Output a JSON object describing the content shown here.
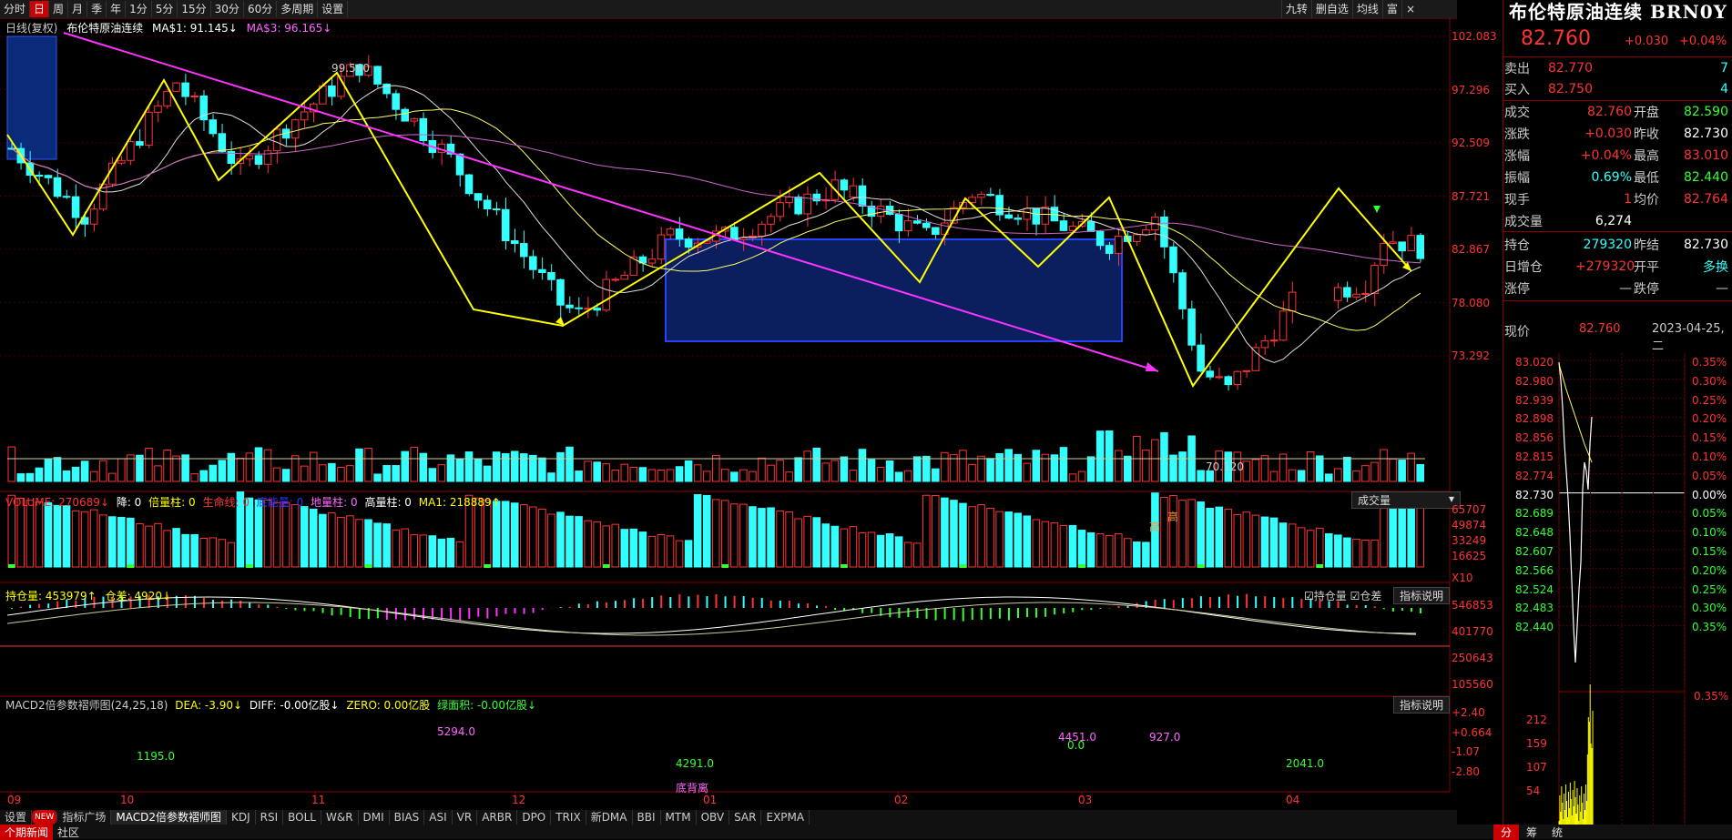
{
  "toolbar": {
    "periods": [
      "分时",
      "日",
      "周",
      "月",
      "季",
      "年",
      "1分",
      "5分",
      "15分",
      "30分",
      "60分",
      "多周期",
      "设置"
    ],
    "active_period": "日",
    "right_items": [
      "九转",
      "删自选",
      "均线",
      "富"
    ],
    "close": "×"
  },
  "kline": {
    "header_mode": "日线(复权)",
    "name": "布伦特原油连续",
    "ma1": "MA$1: 91.145↓",
    "ma3": "MA$3: 96.165↓",
    "y_ticks": [
      "102.083",
      "97.296",
      "92.509",
      "87.721",
      "82.867",
      "78.080",
      "73.292"
    ],
    "high_label": "99.560",
    "low_label": "70.120"
  },
  "volume": {
    "header": "VOLUME: 270689↓",
    "items": [
      "降: 0",
      "倍量柱: 0",
      "生命线: 0",
      "底能量: 0",
      "地量柱: 0",
      "高量柱: 0",
      "MA1: 218889↑"
    ],
    "dropdown": "成交量",
    "y_ticks": [
      "65707",
      "49874",
      "33249",
      "16625"
    ],
    "unit": "X10",
    "marks": [
      "高",
      "高"
    ]
  },
  "oi": {
    "header": "持仓量: 453979↑",
    "sub": "仓差: 4920↓",
    "checks": [
      "持仓量",
      "仓差"
    ],
    "explain": "指标说明",
    "y_ticks": [
      "546853",
      "401770",
      "250643",
      "105560"
    ]
  },
  "macd": {
    "header": "MACD2倍参数褶师图(24,25,18)",
    "dea": "DEA: -3.90↓",
    "diff": "DIFF: -0.00亿股↓",
    "zero": "ZERO: 0.00亿股",
    "green": "绿面积: -0.00亿股↓",
    "explain": "指标说明",
    "y_ticks": [
      "+2.40",
      "+0.664",
      "-1.07",
      "-2.80"
    ],
    "labels": [
      "1195.0",
      "5294.0",
      "4291.0",
      "底背离",
      "4451.0",
      "0.0",
      "927.0",
      "2041.0"
    ]
  },
  "x_axis": [
    "09",
    "10",
    "11",
    "12",
    "01",
    "02",
    "03",
    "04"
  ],
  "tabs": [
    "设置",
    "NEW",
    "指标广场",
    "MACD2倍参数褶师图",
    "KDJ",
    "RSI",
    "BOLL",
    "W&R",
    "DMI",
    "BIAS",
    "ASI",
    "VR",
    "ARBR",
    "DPO",
    "TRIX",
    "新DMA",
    "BBI",
    "MTM",
    "OBV",
    "SAR",
    "EXPMA"
  ],
  "bottom": [
    "个期新闻",
    "社区"
  ],
  "quote": {
    "title": "布伦特原油连续 BRN0Y",
    "price": "82.760",
    "change": "+0.030",
    "pct": "+0.04%",
    "sell_label": "卖出",
    "sell": "82.770",
    "sell_vol": "7",
    "buy_label": "买入",
    "buy": "82.750",
    "buy_vol": "4",
    "rows": [
      {
        "l1": "成交",
        "v1": "82.760",
        "l2": "开盘",
        "v2": "82.590"
      },
      {
        "l1": "涨跌",
        "v1": "+0.030",
        "l2": "昨收",
        "v2": "82.730"
      },
      {
        "l1": "涨幅",
        "v1": "+0.04%",
        "l2": "最高",
        "v2": "83.010"
      },
      {
        "l1": "振幅",
        "v1": "0.69%",
        "l2": "最低",
        "v2": "82.440"
      },
      {
        "l1": "现手",
        "v1": "1",
        "l2": "均价",
        "v2": "82.764"
      },
      {
        "l1": "成交量",
        "v1": "6,274",
        "l2": "",
        "v2": ""
      }
    ],
    "rows2": [
      {
        "l1": "持仓",
        "v1": "279320",
        "l2": "昨结",
        "v2": "82.730"
      },
      {
        "l1": "日增仓",
        "v1": "+279320",
        "l2": "开平",
        "v2": "多换"
      },
      {
        "l1": "涨停",
        "v1": "—",
        "l2": "跌停",
        "v2": "—"
      }
    ],
    "now_label": "现价",
    "now_price": "82.760",
    "date": "2023-04-25,二"
  },
  "mini": {
    "left_ticks": [
      "83.020",
      "82.980",
      "82.939",
      "82.898",
      "82.856",
      "82.815",
      "82.774",
      "82.730",
      "82.689",
      "82.648",
      "82.607",
      "82.566",
      "82.524",
      "82.483",
      "82.440"
    ],
    "right_ticks": [
      "0.35%",
      "0.30%",
      "0.25%",
      "0.20%",
      "0.15%",
      "0.10%",
      "0.05%",
      "0.00%",
      "0.05%",
      "0.10%",
      "0.15%",
      "0.20%",
      "0.25%",
      "0.30%",
      "0.35%"
    ],
    "vol_ticks": [
      "212",
      "159",
      "107",
      "54"
    ],
    "tabs": [
      "分",
      "筹",
      "统"
    ]
  },
  "colors": {
    "up": "#ff3333",
    "down": "#33ffff",
    "ma_white": "#dddddd",
    "ma_yellow": "#ffff66",
    "ma_pink": "#ff66ff",
    "zigzag": "#ffff00",
    "trend": "#ff33ff",
    "box": "#0a1e6e"
  }
}
